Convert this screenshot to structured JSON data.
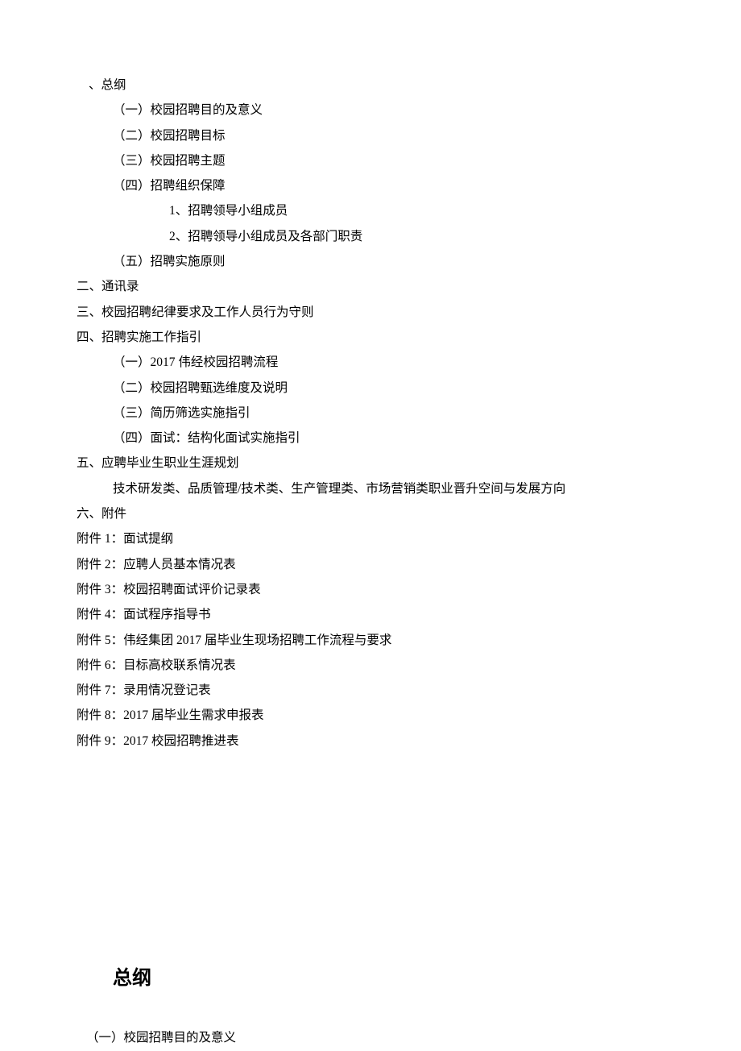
{
  "toc": {
    "s1": {
      "title": "、总纲",
      "items": [
        "（一）校园招聘目的及意义",
        "（二）校园招聘目标",
        "（三）校园招聘主题",
        "（四）招聘组织保障"
      ],
      "s1_4_sub": [
        "1、招聘领导小组成员",
        "2、招聘领导小组成员及各部门职责"
      ],
      "item5": "（五）招聘实施原则"
    },
    "s2": "二、通讯录",
    "s3": "三、校园招聘纪律要求及工作人员行为守则",
    "s4": {
      "title": "四、招聘实施工作指引",
      "items": [
        "（一）2017 伟经校园招聘流程",
        "（二）校园招聘甄选维度及说明",
        "（三）简历筛选实施指引",
        "（四）面试：结构化面试实施指引"
      ]
    },
    "s5": {
      "title": "五、应聘毕业生职业生涯规划",
      "desc": "技术研发类、品质管理/技术类、生产管理类、市场营销类职业晋升空间与发展方向"
    },
    "s6": "六、附件",
    "attachments": [
      "附件 1：面试提纲",
      "附件 2：应聘人员基本情况表",
      "附件 3：校园招聘面试评价记录表",
      "附件 4：面试程序指导书",
      "附件 5：伟经集团 2017 届毕业生现场招聘工作流程与要求",
      "附件 6：目标高校联系情况表",
      "附件 7：录用情况登记表",
      "附件 8：2017 届毕业生需求申报表",
      "附件 9：2017 校园招聘推进表"
    ]
  },
  "body": {
    "section_title": "总纲",
    "sub1": "（一）校园招聘目的及意义"
  }
}
